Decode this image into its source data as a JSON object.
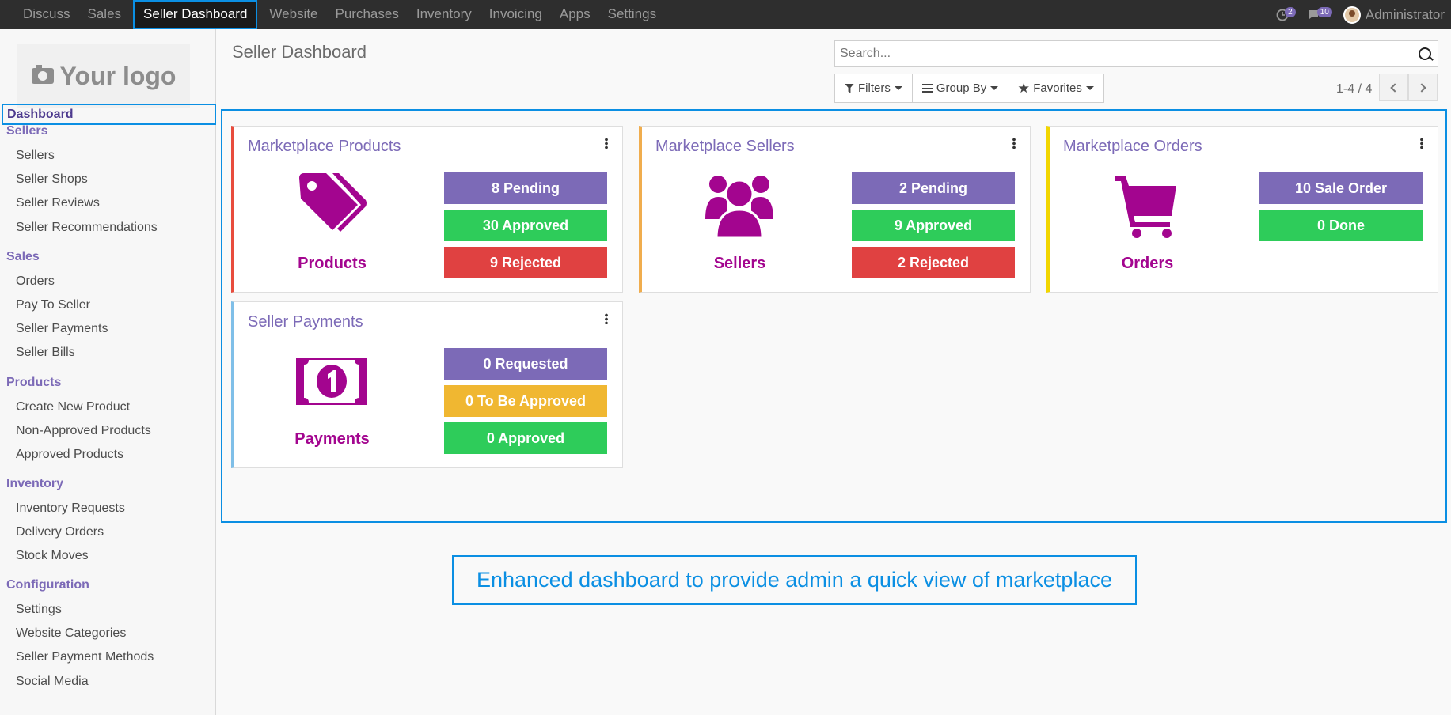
{
  "topnav": {
    "menus": [
      "Discuss",
      "Sales",
      "Seller Dashboard",
      "Website",
      "Purchases",
      "Inventory",
      "Invoicing",
      "Apps",
      "Settings"
    ],
    "activities_count": "2",
    "messages_count": "10",
    "user": "Administrator"
  },
  "sidebar": {
    "logo_text": "Your logo",
    "dashboard": "Dashboard",
    "sections": [
      {
        "title": "Sellers",
        "items": [
          "Sellers",
          "Seller Shops",
          "Seller Reviews",
          "Seller Recommendations"
        ]
      },
      {
        "title": "Sales",
        "items": [
          "Orders",
          "Pay To Seller",
          "Seller Payments",
          "Seller Bills"
        ]
      },
      {
        "title": "Products",
        "items": [
          "Create New Product",
          "Non-Approved Products",
          "Approved Products"
        ]
      },
      {
        "title": "Inventory",
        "items": [
          "Inventory Requests",
          "Delivery Orders",
          "Stock Moves"
        ]
      },
      {
        "title": "Configuration",
        "items": [
          "Settings",
          "Website Categories",
          "Seller Payment Methods",
          "Social Media"
        ]
      }
    ]
  },
  "control": {
    "breadcrumb": "Seller Dashboard",
    "search_placeholder": "Search...",
    "filters": "Filters",
    "group_by": "Group By",
    "favorites": "Favorites",
    "pager": "1-4 / 4"
  },
  "cards": [
    {
      "title": "Marketplace Products",
      "label": "Products",
      "icon": "tags-icon",
      "border": "#e84c3d",
      "stats": [
        {
          "text": "8 Pending",
          "color": "#7c6ab7"
        },
        {
          "text": "30 Approved",
          "color": "#2ecc5a"
        },
        {
          "text": "9 Rejected",
          "color": "#e04141"
        }
      ]
    },
    {
      "title": "Marketplace Sellers",
      "label": "Sellers",
      "icon": "users-icon",
      "border": "#f0ad4e",
      "stats": [
        {
          "text": "2 Pending",
          "color": "#7c6ab7"
        },
        {
          "text": "9 Approved",
          "color": "#2ecc5a"
        },
        {
          "text": "2 Rejected",
          "color": "#e04141"
        }
      ]
    },
    {
      "title": "Marketplace Orders",
      "label": "Orders",
      "icon": "cart-icon",
      "border": "#f2d600",
      "stats": [
        {
          "text": "10 Sale Order",
          "color": "#7c6ab7"
        },
        {
          "text": "0 Done",
          "color": "#2ecc5a"
        }
      ]
    },
    {
      "title": "Seller Payments",
      "label": "Payments",
      "icon": "money-icon",
      "border": "#7fbfe8",
      "stats": [
        {
          "text": "0 Requested",
          "color": "#7c6ab7"
        },
        {
          "text": "0 To Be Approved",
          "color": "#f0b731"
        },
        {
          "text": "0 Approved",
          "color": "#2ecc5a"
        }
      ]
    }
  ],
  "caption": "Enhanced dashboard to provide admin a quick view of marketplace",
  "colors": {
    "accent": "#7c6ab7",
    "icon": "#a3058f",
    "highlight": "#0b8fe3"
  }
}
